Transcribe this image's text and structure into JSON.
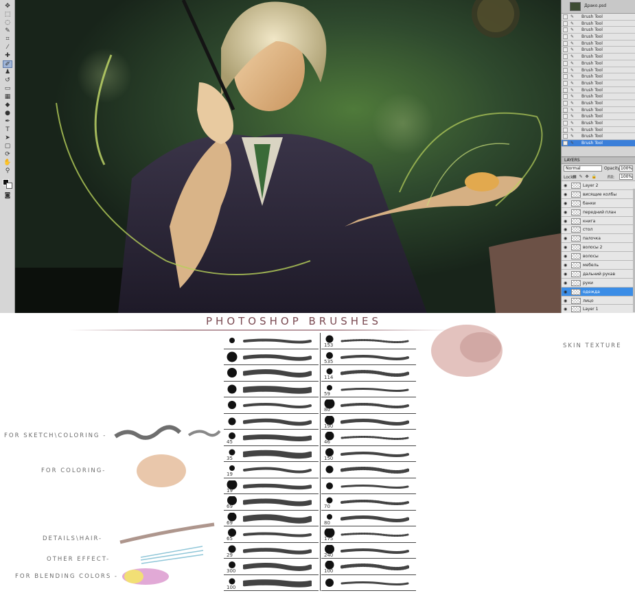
{
  "app": {
    "history": {
      "document_name": "Драко.psd",
      "entries": [
        "Brush Tool",
        "Brush Tool",
        "Brush Tool",
        "Brush Tool",
        "Brush Tool",
        "Brush Tool",
        "Brush Tool",
        "Brush Tool",
        "Brush Tool",
        "Brush Tool",
        "Brush Tool",
        "Brush Tool",
        "Brush Tool",
        "Brush Tool",
        "Brush Tool",
        "Brush Tool",
        "Brush Tool",
        "Brush Tool",
        "Brush Tool",
        "Brush Tool"
      ],
      "selected_index": 19
    },
    "layers": {
      "tab": "LAYERS",
      "blend_mode": "Normal",
      "opacity_label": "Opacity:",
      "opacity": "100%",
      "lock_label": "Lock:",
      "fill_label": "Fill:",
      "fill": "100%",
      "items": [
        "Layer 2",
        "висящие колбы",
        "банки",
        "передний план",
        "книга",
        "стол",
        "палочка",
        "волосы 2",
        "волосы",
        "мебель",
        "дальний рукав",
        "руки",
        "одежда",
        "лицо",
        "Layer 1"
      ],
      "selected_index": 12
    }
  },
  "brushes": {
    "title": "PHOTOSHOP BRUSHES",
    "categories": {
      "sketch": "FOR SKETCH\\COLORING -",
      "coloring": "FOR COLORING-",
      "details": "DETAILS\\HAIR-",
      "other": "OTHER EFFECT-",
      "blending": "FOR BLENDING COLORS -",
      "skin": "SKIN TEXTURE"
    },
    "left_column": [
      "",
      "",
      "",
      "",
      "",
      "",
      "45",
      "35",
      "19",
      "19",
      "69",
      "69",
      "65",
      "29",
      "300",
      "100"
    ],
    "right_column": [
      "153",
      "535",
      "114",
      "59",
      "80",
      "190",
      "46",
      "150",
      "",
      "",
      "70",
      "80",
      "175",
      "240",
      "100",
      ""
    ],
    "colors": {
      "accent_title": "#7a4a52",
      "selection_blue": "#3b8de6"
    }
  }
}
